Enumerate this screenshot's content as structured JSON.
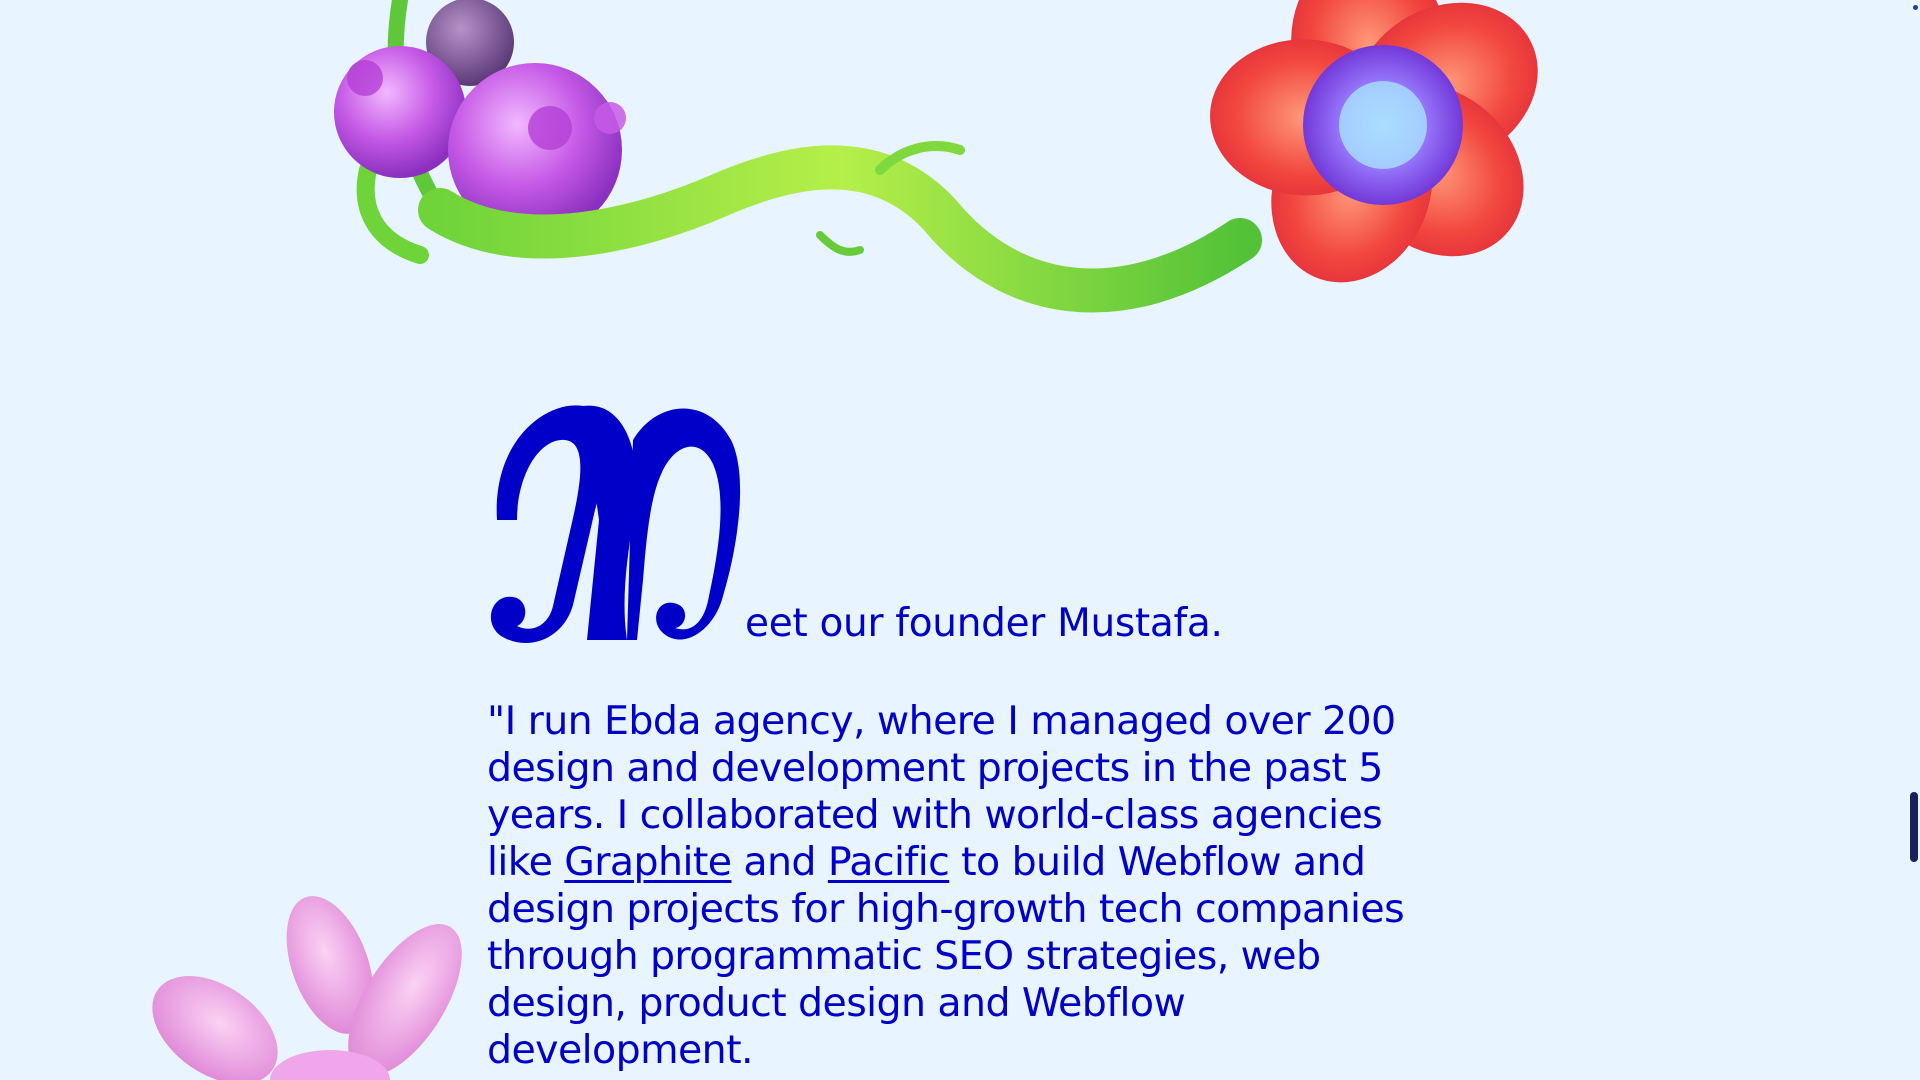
{
  "founder": {
    "dropcap": "M",
    "heading_rest": "eet our founder Mustafa.",
    "quote_part1": "\"I run Ebda agency, where I managed over 200 design and development projects in the past 5 years. I collaborated with world-class agencies like ",
    "link_graphite": "Graphite",
    "quote_and": " and ",
    "link_pacific": "Pacific",
    "quote_part2": " to build Webflow and design projects for high-growth tech companies through programmatic SEO strategies, web design, product design and Webflow development."
  },
  "decor": {
    "illustrations": [
      "berry-cluster-illustration",
      "vine-illustration",
      "red-flower-illustration",
      "pink-flower-illustration"
    ]
  },
  "colors": {
    "background": "#e8f4ff",
    "text": "#0000c8"
  }
}
